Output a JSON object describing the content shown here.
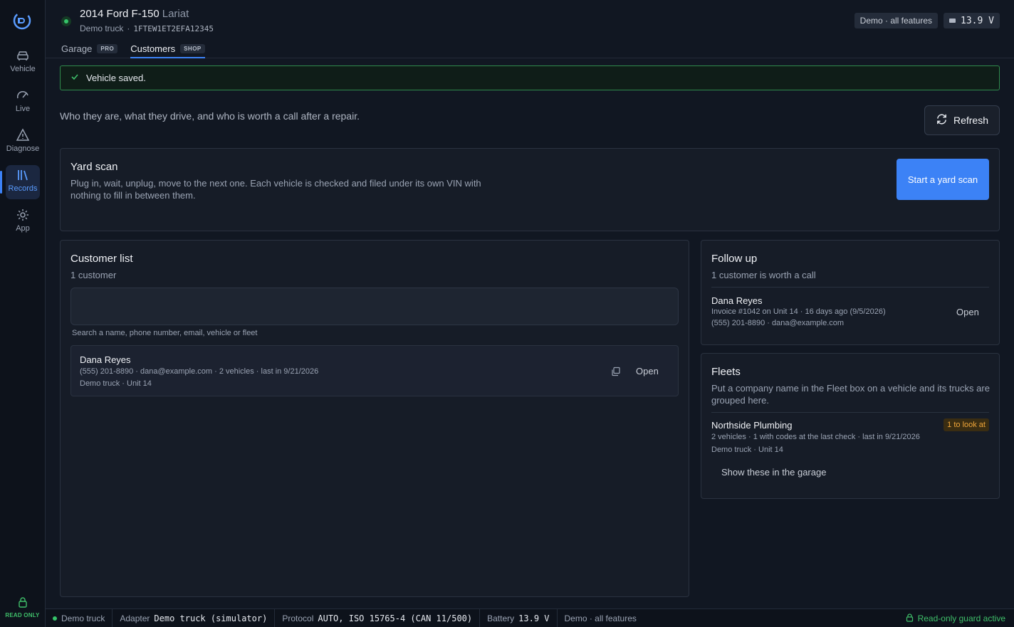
{
  "sidebar": {
    "items": [
      {
        "label": "Vehicle",
        "icon": "car-icon"
      },
      {
        "label": "Live",
        "icon": "gauge-icon"
      },
      {
        "label": "Diagnose",
        "icon": "warning-icon"
      },
      {
        "label": "Records",
        "icon": "records-icon",
        "active": true
      },
      {
        "label": "App",
        "icon": "gear-icon"
      }
    ],
    "readonly_label": "READ ONLY"
  },
  "header": {
    "vehicle_name": "2014 Ford F-150",
    "vehicle_trim": "Lariat",
    "vehicle_source": "Demo truck",
    "vin": "1FTEW1ET2EFA12345",
    "tabs": [
      {
        "label": "Garage",
        "tag": "PRO"
      },
      {
        "label": "Customers",
        "tag": "SHOP",
        "active": true
      }
    ],
    "mode_chip": "Demo · all features",
    "voltage": "13.9 V"
  },
  "banner": {
    "text": "Vehicle saved."
  },
  "intro": "Who they are, what they drive, and who is worth a call after a repair.",
  "refresh_label": "Refresh",
  "yard_scan": {
    "title": "Yard scan",
    "description": "Plug in, wait, unplug, move to the next one. Each vehicle is checked and filed under its own VIN with nothing to fill in between them.",
    "button": "Start a yard scan"
  },
  "customer_list": {
    "title": "Customer list",
    "count": "1 customer",
    "search_value": "",
    "search_help": "Search a name, phone number, email, vehicle or fleet",
    "rows": [
      {
        "name": "Dana Reyes",
        "line1": "(555) 201-8890 · dana@example.com · 2 vehicles · last in 9/21/2026",
        "line2": "Demo truck · Unit 14",
        "open": "Open"
      }
    ]
  },
  "follow_up": {
    "title": "Follow up",
    "subtitle": "1 customer is worth a call",
    "items": [
      {
        "name": "Dana Reyes",
        "line1": "Invoice #1042 on Unit 14 · 16 days ago (9/5/2026)",
        "line2": "(555) 201-8890 · dana@example.com",
        "open": "Open"
      }
    ]
  },
  "fleets": {
    "title": "Fleets",
    "description": "Put a company name in the Fleet box on a vehicle and its trucks are grouped here.",
    "items": [
      {
        "name": "Northside Plumbing",
        "badge": "1 to look at",
        "line1": "2 vehicles · 1 with codes at the last check · last in 9/21/2026",
        "line2": "Demo truck · Unit 14",
        "action": "Show these in the garage"
      }
    ]
  },
  "statusbar": {
    "source": "Demo truck",
    "adapter_label": "Adapter",
    "adapter_value": "Demo truck (simulator)",
    "protocol_label": "Protocol",
    "protocol_value": "AUTO, ISO 15765-4 (CAN 11/500)",
    "battery_label": "Battery",
    "battery_value": "13.9 V",
    "mode": "Demo · all features",
    "guard": "Read-only guard active"
  },
  "colors": {
    "accent": "#3c82f6",
    "success": "#3fbf6a",
    "warning": "#f0a63a",
    "background": "#111722"
  }
}
